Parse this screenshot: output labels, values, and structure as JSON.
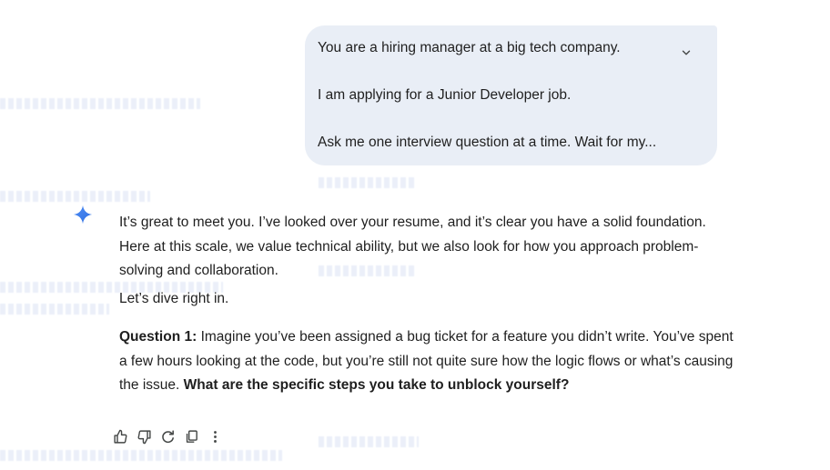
{
  "user_prompt": {
    "line1": "You are a hiring manager at a big tech company.",
    "line2": "I am applying for a Junior Developer job.",
    "line3": "Ask me one interview question at a time. Wait for my...",
    "expand_icon": "chevron-down-icon"
  },
  "response": {
    "intro": "It’s great to meet you. I’ve looked over your resume, and it’s clear you have a solid foundation. Here at this scale, we value technical ability, but we also look for how you approach problem-solving and collaboration.",
    "dive": "Let’s dive right in.",
    "question_label": "Question 1:",
    "question_body": " Imagine you’ve been assigned a bug ticket for a feature you didn’t write. You’ve spent a few hours looking at the code, but you’re still not quite sure how the logic flows or what’s causing the issue. ",
    "question_emphasis": "What are the specific steps you take to unblock yourself?"
  },
  "actions": [
    {
      "icon": "thumbs-up-icon"
    },
    {
      "icon": "thumbs-down-icon"
    },
    {
      "icon": "redo-icon"
    },
    {
      "icon": "copy-icon"
    },
    {
      "icon": "more-vertical-icon"
    }
  ],
  "colors": {
    "bubble_bg": "#e9eef6",
    "text": "#1f1f1f",
    "spark": "#4285f4",
    "icon": "#444746"
  }
}
